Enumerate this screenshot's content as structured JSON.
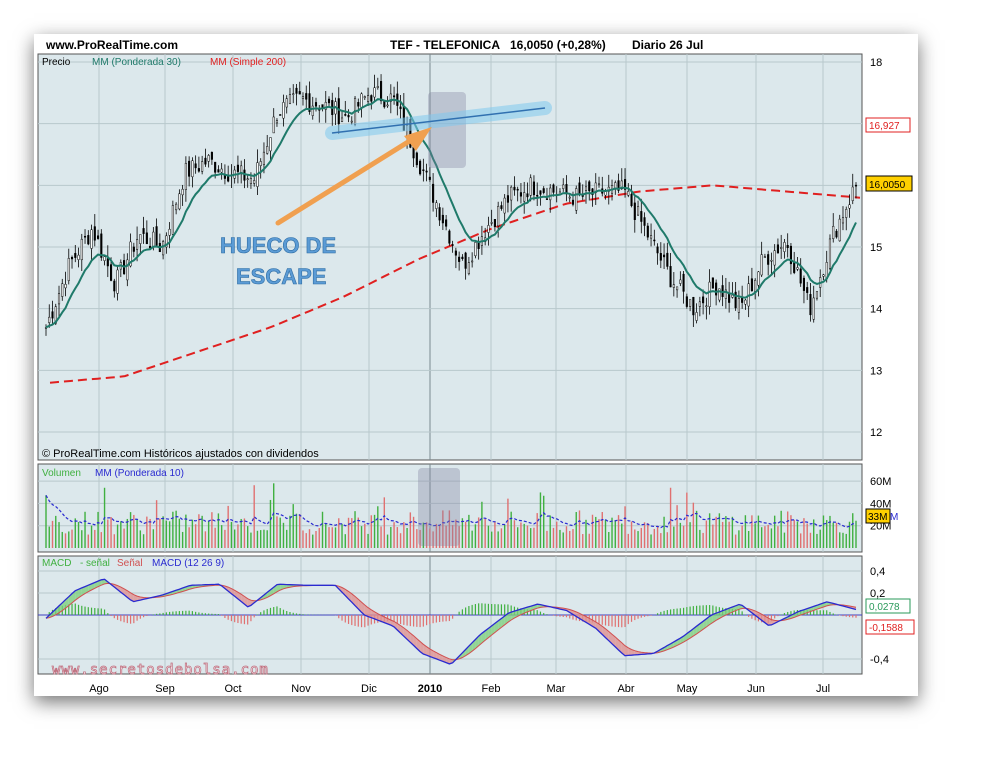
{
  "header": {
    "site": "www.ProRealTime.com",
    "ticker": "TEF - TELEFONICA",
    "last": "16,0050 (+0,28%)",
    "period": "Diario  26 Jul"
  },
  "price_panel": {
    "legend": {
      "precio": "Precio",
      "ma1": "MM (Ponderada 30)",
      "ma2": "MM (Simple 200)"
    },
    "credit": "© ProRealTime.com  Históricos ajustados con dividendos",
    "badge_ma200": "16,927",
    "badge_last": "16,0050"
  },
  "volume_panel": {
    "legend": {
      "vol": "Volumen",
      "ma": "MM (Ponderada 10)"
    },
    "badge": "33M",
    "badge_suffix": "M"
  },
  "macd_panel": {
    "legend": {
      "a": "MACD",
      "sep": "-",
      "b": "señal",
      "c": "Señal",
      "d": "MACD (12 26 9)"
    },
    "badge_macd": "0,0278",
    "badge_signal": "-0,1588"
  },
  "annotation": {
    "line1": "HUECO DE",
    "line2": "ESCAPE"
  },
  "watermark": "www.secretosdebolsa.com",
  "colors": {
    "background": "#dce8ec",
    "ma30": "#1f7a6a",
    "ma200": "#e02020",
    "macd": "#2a2ad0",
    "signal": "#d05050",
    "up": "#40b040",
    "down": "#e07070",
    "arrow": "#f0a050",
    "annotation": "#5b9bd5"
  },
  "chart_data": {
    "type": "candlestick",
    "x_labels": [
      "Ago",
      "Sep",
      "Oct",
      "Nov",
      "Dic",
      "2010",
      "Feb",
      "Mar",
      "Abr",
      "May",
      "Jun",
      "Jul"
    ],
    "y_ticks": [
      12,
      13,
      14,
      15,
      "16,927",
      18
    ],
    "ylim": [
      11.8,
      18.1
    ],
    "close_anchors": [
      [
        "Ago",
        13.7
      ],
      [
        "",
        14.7
      ],
      [
        "",
        15.3
      ],
      [
        "",
        14.4
      ],
      [
        "Sep",
        15.2
      ],
      [
        "",
        15.0
      ],
      [
        "Oct",
        16.2
      ],
      [
        "",
        16.4
      ],
      [
        "",
        16.2
      ],
      [
        "Nov",
        16.1
      ],
      [
        "",
        17.2
      ],
      [
        "",
        17.4
      ],
      [
        "Dic",
        17.3
      ],
      [
        "",
        17.1
      ],
      [
        "",
        17.5
      ],
      [
        "2010",
        17.4
      ],
      [
        "",
        16.5
      ],
      [
        "",
        15.6
      ],
      [
        "Feb",
        14.7
      ],
      [
        "",
        15.3
      ],
      [
        "",
        15.8
      ],
      [
        "Mar",
        16.0
      ],
      [
        "",
        15.9
      ],
      [
        "",
        15.8
      ],
      [
        "Abr",
        15.9
      ],
      [
        "",
        15.9
      ],
      [
        "",
        15.2
      ],
      [
        "May",
        14.5
      ],
      [
        "",
        14.0
      ],
      [
        "",
        14.4
      ],
      [
        "Jun",
        14.0
      ],
      [
        "",
        14.8
      ],
      [
        "",
        15.1
      ],
      [
        "Jul",
        14.0
      ],
      [
        "",
        15.2
      ],
      [
        "",
        16.005
      ]
    ],
    "ma200_anchors": [
      [
        12.8
      ],
      [
        12.9
      ],
      [
        13.3
      ],
      [
        13.7
      ],
      [
        14.2
      ],
      [
        14.8
      ],
      [
        15.3
      ],
      [
        15.7
      ],
      [
        15.9
      ],
      [
        16.0
      ],
      [
        15.9
      ],
      [
        15.8
      ]
    ],
    "volume_ticks": [
      "60M",
      "40M",
      "33M",
      "20M"
    ],
    "macd_ticks": [
      "0,4",
      "0,2",
      "0,0278",
      "-0,1588",
      "-0,4"
    ],
    "macd_anchors": [
      [
        -0.03
      ],
      [
        0.22
      ],
      [
        0.33
      ],
      [
        0.12
      ],
      [
        0.18
      ],
      [
        0.27
      ],
      [
        0.28
      ],
      [
        0.07
      ],
      [
        0.28
      ],
      [
        0.27
      ],
      [
        0.27
      ],
      [
        0.0
      ],
      [
        -0.1
      ],
      [
        -0.35
      ],
      [
        -0.45
      ],
      [
        -0.18
      ],
      [
        0.02
      ],
      [
        0.1
      ],
      [
        0.04
      ],
      [
        -0.12
      ],
      [
        -0.37
      ],
      [
        -0.35
      ],
      [
        -0.2
      ],
      [
        0.0
      ],
      [
        0.1
      ],
      [
        -0.1
      ],
      [
        0.03
      ],
      [
        0.12
      ],
      [
        0.05
      ]
    ]
  }
}
